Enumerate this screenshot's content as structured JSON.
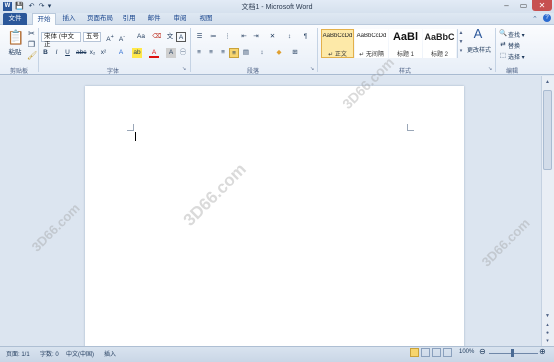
{
  "window": {
    "title": "文档1 - Microsoft Word",
    "minimize": "–",
    "restore": "▭",
    "close": "✕"
  },
  "quick_access": {
    "save": "💾",
    "undo": "↶",
    "redo": "↷",
    "customize": "▾"
  },
  "tabs": [
    "文件",
    "开始",
    "插入",
    "页面布局",
    "引用",
    "邮件",
    "审阅",
    "视图"
  ],
  "ribbon": {
    "clipboard": {
      "paste": "粘贴",
      "group": "剪贴板"
    },
    "font": {
      "name": "宋体 (中文正",
      "size": "五号",
      "bold": "B",
      "italic": "I",
      "underline": "U",
      "group": "字体"
    },
    "paragraph": {
      "group": "段落"
    },
    "styles": {
      "group": "样式",
      "items": [
        {
          "preview": "AaBbCcDd",
          "name": "↵ 正文"
        },
        {
          "preview": "AaBbCcDd",
          "name": "↵ 无间隔"
        },
        {
          "preview": "AaBl",
          "name": "标题 1"
        },
        {
          "preview": "AaBbC",
          "name": "标题 2"
        }
      ],
      "change": "更改样式"
    },
    "editing": {
      "group": "编辑",
      "find": "查找 ▾",
      "replace": "替换",
      "select": "选择 ▾"
    }
  },
  "watermark": "3D66.com",
  "status": {
    "page": "页面: 1/1",
    "words": "字数: 0",
    "lang": "中文(中国)",
    "mode": "插入",
    "zoom": "100%"
  }
}
